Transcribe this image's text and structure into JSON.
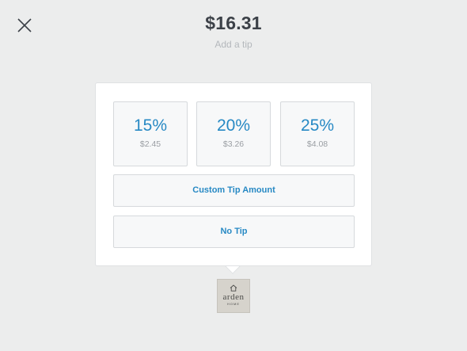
{
  "header": {
    "total": "$16.31",
    "subtitle": "Add a tip"
  },
  "tip_options": [
    {
      "percent": "15%",
      "amount": "$2.45"
    },
    {
      "percent": "20%",
      "amount": "$3.26"
    },
    {
      "percent": "25%",
      "amount": "$4.08"
    }
  ],
  "buttons": {
    "custom": "Custom Tip Amount",
    "no_tip": "No Tip"
  },
  "merchant": {
    "logo_text": "arden",
    "logo_subtext": "HOME"
  },
  "icons": {
    "close": "close-icon",
    "logo_house": "house-icon"
  },
  "colors": {
    "accent": "#2789c4",
    "background": "#eceded",
    "text_dark": "#3c4148",
    "text_muted": "#b4b8bc"
  }
}
